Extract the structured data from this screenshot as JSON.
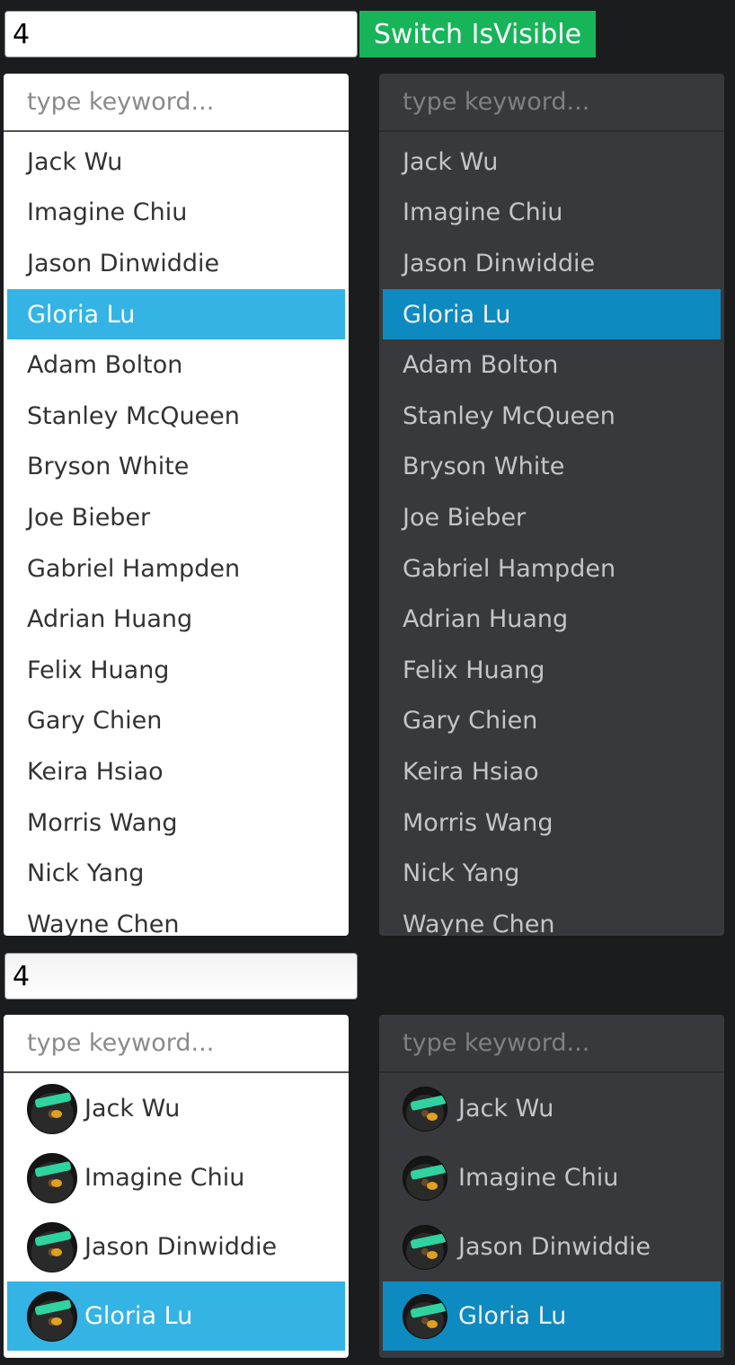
{
  "top_controls": {
    "number_value": "4",
    "switch_label": "Switch IsVisible"
  },
  "bottom_controls": {
    "number_value": "4"
  },
  "search": {
    "placeholder": "type keyword..."
  },
  "names": [
    "Jack Wu",
    "Imagine Chiu",
    "Jason Dinwiddie",
    "Gloria Lu",
    "Adam Bolton",
    "Stanley McQueen",
    "Bryson White",
    "Joe Bieber",
    "Gabriel Hampden",
    "Adrian Huang",
    "Felix Huang",
    "Gary Chien",
    "Keira Hsiao",
    "Morris Wang",
    "Nick Yang",
    "Wayne Chen"
  ],
  "avatar_names": [
    "Jack Wu",
    "Imagine Chiu",
    "Jason Dinwiddie",
    "Gloria Lu"
  ],
  "selected_index": 3,
  "colors": {
    "button_green": "#17b45a",
    "selected_light": "#34b4e4",
    "selected_dark": "#0d8ac0",
    "dark_panel": "#38393c"
  },
  "icons": {
    "avatar": "avatar-icon"
  }
}
